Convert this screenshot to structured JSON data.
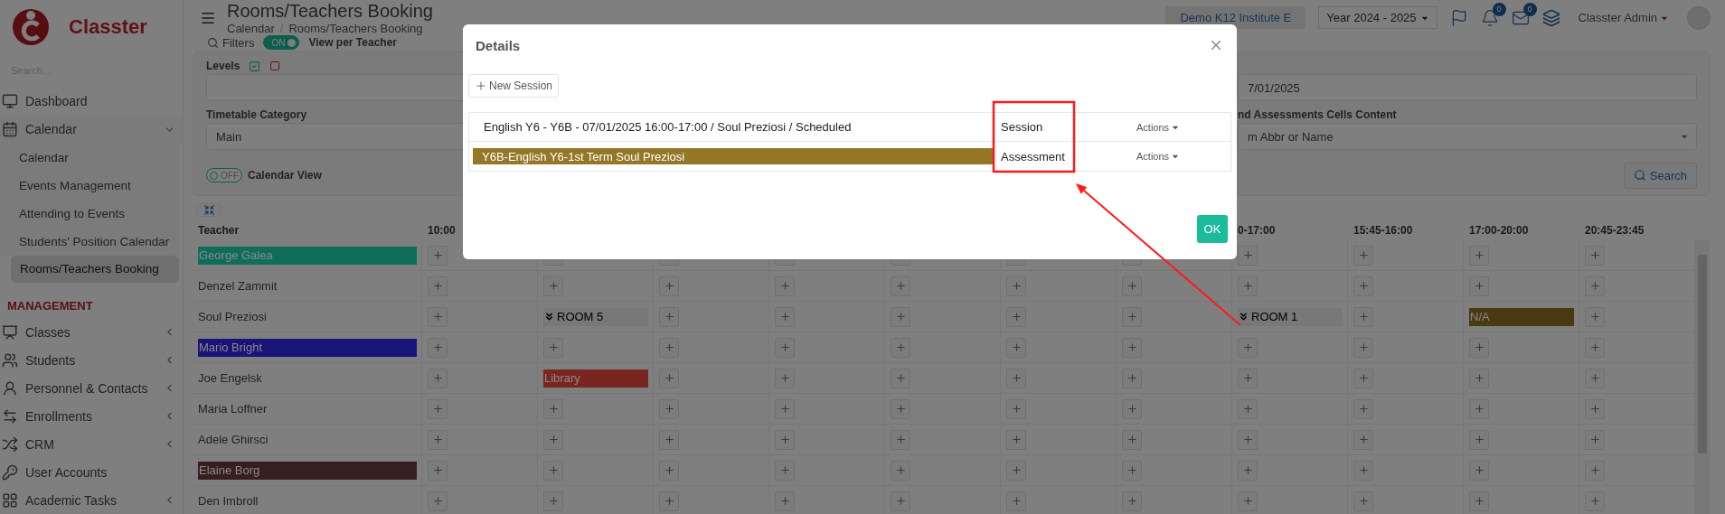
{
  "sidebar": {
    "logo": "Classter",
    "search": {
      "placeholder": "Search..."
    },
    "items": [
      {
        "kind": "link",
        "label": "Dashboard"
      },
      {
        "kind": "group",
        "label": "Calendar",
        "expanded": true,
        "children": [
          {
            "label": "Calendar",
            "selected": false
          },
          {
            "label": "Events Management",
            "selected": false
          },
          {
            "label": "Attending to Events",
            "selected": false
          },
          {
            "label": "Students' Position Calendar",
            "selected": false
          },
          {
            "label": "Rooms/Teachers Booking",
            "selected": true
          }
        ]
      },
      {
        "kind": "section",
        "label": "MANAGEMENT"
      },
      {
        "kind": "group",
        "label": "Classes",
        "expanded": false
      },
      {
        "kind": "group",
        "label": "Students",
        "expanded": false
      },
      {
        "kind": "group",
        "label": "Personnel & Contacts",
        "expanded": false
      },
      {
        "kind": "group",
        "label": "Enrollments",
        "expanded": false
      },
      {
        "kind": "group",
        "label": "CRM",
        "expanded": false
      },
      {
        "kind": "link",
        "label": "User Accounts"
      },
      {
        "kind": "group",
        "label": "Academic Tasks",
        "expanded": false
      }
    ]
  },
  "header": {
    "title": "Rooms/Teachers Booking",
    "breadcrumb": [
      "Calendar",
      "Rooms/Teachers Booking"
    ],
    "breadcrumb_separator": "/",
    "institute": "Demo K12 Institute E",
    "year": "Year 2024 - 2025",
    "notifications": "0",
    "messages": "0",
    "user": "Classter Admin"
  },
  "filters": {
    "label": "Filters",
    "view_toggle": {
      "on": true,
      "text": "ON",
      "label": "View per Teacher"
    },
    "levels": {
      "label": "Levels"
    },
    "timetable_category": {
      "label": "Timetable Category",
      "value": "Main"
    },
    "calendar_toggle": {
      "on": false,
      "text": "OFF",
      "label": "Calendar View"
    },
    "date_field": {
      "value": "7/01/2025"
    },
    "cells_content": {
      "label": "nd Assessments Cells Content",
      "value": "m Abbr or Name"
    },
    "search_button": "Search"
  },
  "table": {
    "columns": [
      "Teacher",
      "10:00",
      "0-17:00",
      "15:45-16:00",
      "17:00-20:00",
      "20:45-23:45"
    ],
    "rows": [
      {
        "teacher": "George Galea",
        "color": "#0e6e5a",
        "cells": [
          {
            "kind": "add"
          },
          {
            "kind": "add"
          },
          {
            "kind": "add"
          },
          {
            "kind": "add"
          },
          {
            "kind": "add"
          },
          {
            "kind": "add"
          },
          {
            "kind": "add"
          },
          {
            "kind": "add"
          },
          {
            "kind": "add"
          },
          {
            "kind": "add"
          },
          {
            "kind": "add"
          }
        ]
      },
      {
        "teacher": "Denzel Zammit",
        "cells": [
          {
            "kind": "add"
          },
          {
            "kind": "add"
          },
          {
            "kind": "add"
          },
          {
            "kind": "add"
          },
          {
            "kind": "add"
          },
          {
            "kind": "add"
          },
          {
            "kind": "add"
          },
          {
            "kind": "add"
          },
          {
            "kind": "add"
          },
          {
            "kind": "add"
          },
          {
            "kind": "add"
          }
        ]
      },
      {
        "teacher": "Soul Preziosi",
        "cells": [
          {
            "kind": "add"
          },
          {
            "kind": "room",
            "text": "ROOM 5"
          },
          {
            "kind": "add"
          },
          {
            "kind": "add"
          },
          {
            "kind": "add"
          },
          {
            "kind": "add"
          },
          {
            "kind": "add"
          },
          {
            "kind": "room",
            "text": "ROOM 1"
          },
          {
            "kind": "add"
          },
          {
            "kind": "tag",
            "text": "N/A",
            "color": "#4a3a12"
          },
          {
            "kind": "add"
          }
        ]
      },
      {
        "teacher": "Mario Bright",
        "color": "#191478",
        "cells": [
          {
            "kind": "add"
          },
          {
            "kind": "add"
          },
          {
            "kind": "add"
          },
          {
            "kind": "add"
          },
          {
            "kind": "add"
          },
          {
            "kind": "add"
          },
          {
            "kind": "add"
          },
          {
            "kind": "add"
          },
          {
            "kind": "add"
          },
          {
            "kind": "add"
          },
          {
            "kind": "add"
          }
        ]
      },
      {
        "teacher": "Joe Engelsk",
        "cells": [
          {
            "kind": "add"
          },
          {
            "kind": "tag",
            "text": "Library",
            "color": "#7a2620"
          },
          {
            "kind": "add"
          },
          {
            "kind": "add"
          },
          {
            "kind": "add"
          },
          {
            "kind": "add"
          },
          {
            "kind": "add"
          },
          {
            "kind": "add"
          },
          {
            "kind": "add"
          },
          {
            "kind": "add"
          },
          {
            "kind": "add"
          }
        ]
      },
      {
        "teacher": "Maria Loffner",
        "cells": [
          {
            "kind": "add"
          },
          {
            "kind": "add"
          },
          {
            "kind": "add"
          },
          {
            "kind": "add"
          },
          {
            "kind": "add"
          },
          {
            "kind": "add"
          },
          {
            "kind": "add"
          },
          {
            "kind": "add"
          },
          {
            "kind": "add"
          },
          {
            "kind": "add"
          },
          {
            "kind": "add"
          }
        ]
      },
      {
        "teacher": "Adele Ghirsci",
        "cells": [
          {
            "kind": "add"
          },
          {
            "kind": "add"
          },
          {
            "kind": "add"
          },
          {
            "kind": "add"
          },
          {
            "kind": "add"
          },
          {
            "kind": "add"
          },
          {
            "kind": "add"
          },
          {
            "kind": "add"
          },
          {
            "kind": "add"
          },
          {
            "kind": "add"
          },
          {
            "kind": "add"
          }
        ]
      },
      {
        "teacher": "Elaine Borg",
        "color": "#381f1f",
        "cells": [
          {
            "kind": "add"
          },
          {
            "kind": "add"
          },
          {
            "kind": "add"
          },
          {
            "kind": "add"
          },
          {
            "kind": "add"
          },
          {
            "kind": "add"
          },
          {
            "kind": "add"
          },
          {
            "kind": "add"
          },
          {
            "kind": "add"
          },
          {
            "kind": "add"
          },
          {
            "kind": "add"
          }
        ]
      },
      {
        "teacher": "Den Imbroll",
        "cells": [
          {
            "kind": "add"
          },
          {
            "kind": "add"
          },
          {
            "kind": "add"
          },
          {
            "kind": "add"
          },
          {
            "kind": "add"
          },
          {
            "kind": "add"
          },
          {
            "kind": "add"
          },
          {
            "kind": "add"
          },
          {
            "kind": "add"
          },
          {
            "kind": "add"
          },
          {
            "kind": "add"
          }
        ]
      }
    ]
  },
  "dialog": {
    "title": "Details",
    "new_session": "New Session",
    "entries": [
      {
        "kind": "session",
        "text": "English Y6 - Y6B - 07/01/2025 16:00-17:00 / Soul Preziosi / Scheduled",
        "type": "Session",
        "actions": "Actions"
      },
      {
        "kind": "assessment",
        "text": "Y6B-English Y6-1st Term Soul Preziosi",
        "color": "#957728",
        "type": "Assessment",
        "actions": "Actions"
      }
    ],
    "ok": "OK"
  }
}
